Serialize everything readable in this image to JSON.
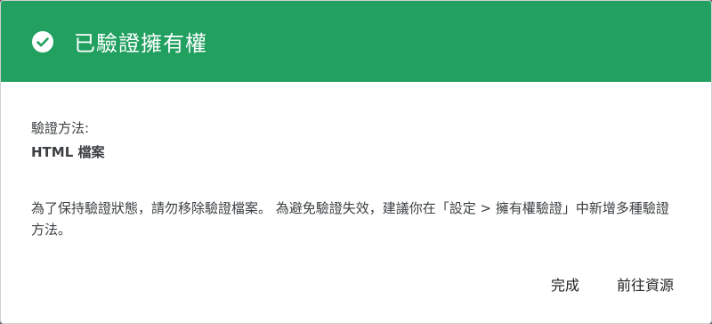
{
  "header": {
    "title": "已驗證擁有權",
    "icon": "check-circle-icon",
    "color": "#21a060"
  },
  "details": {
    "method_label": "驗證方法:",
    "method_value": "HTML 檔案"
  },
  "message": "為了保持驗證狀態，請勿移除驗證檔案。 為避免驗證失效，建議你在「設定 > 擁有權驗證」中新增多種驗證方法。",
  "actions": {
    "done_label": "完成",
    "go_label": "前往資源"
  }
}
